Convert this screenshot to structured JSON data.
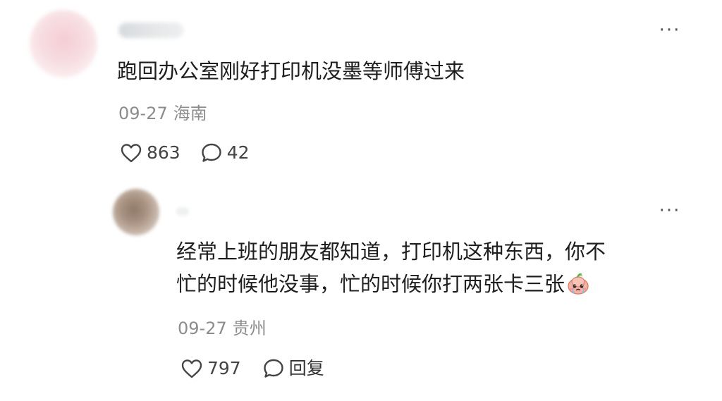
{
  "comment": {
    "username": "",
    "text": "跑回办公室刚好打印机没墨等师傅过来",
    "date": "09-27",
    "location": "海南",
    "likes": "863",
    "replies": "42",
    "more_label": "···"
  },
  "reply": {
    "username": "",
    "text_line1": "经常上班的朋友都知道，打印机这种东西，你不",
    "text_line2": "忙的时候他没事，忙的时候你打两张卡三张",
    "date": "09-27",
    "location": "贵州",
    "likes": "797",
    "reply_label": "回复",
    "more_label": "···"
  },
  "icons": {
    "like": "heart-outline-icon",
    "comment": "speech-bubble-icon",
    "more": "ellipsis-icon",
    "emoji": "crying-bun-emoji"
  },
  "colors": {
    "text": "#1e1e1e",
    "meta": "#8c8c8c",
    "icon": "#444444"
  }
}
